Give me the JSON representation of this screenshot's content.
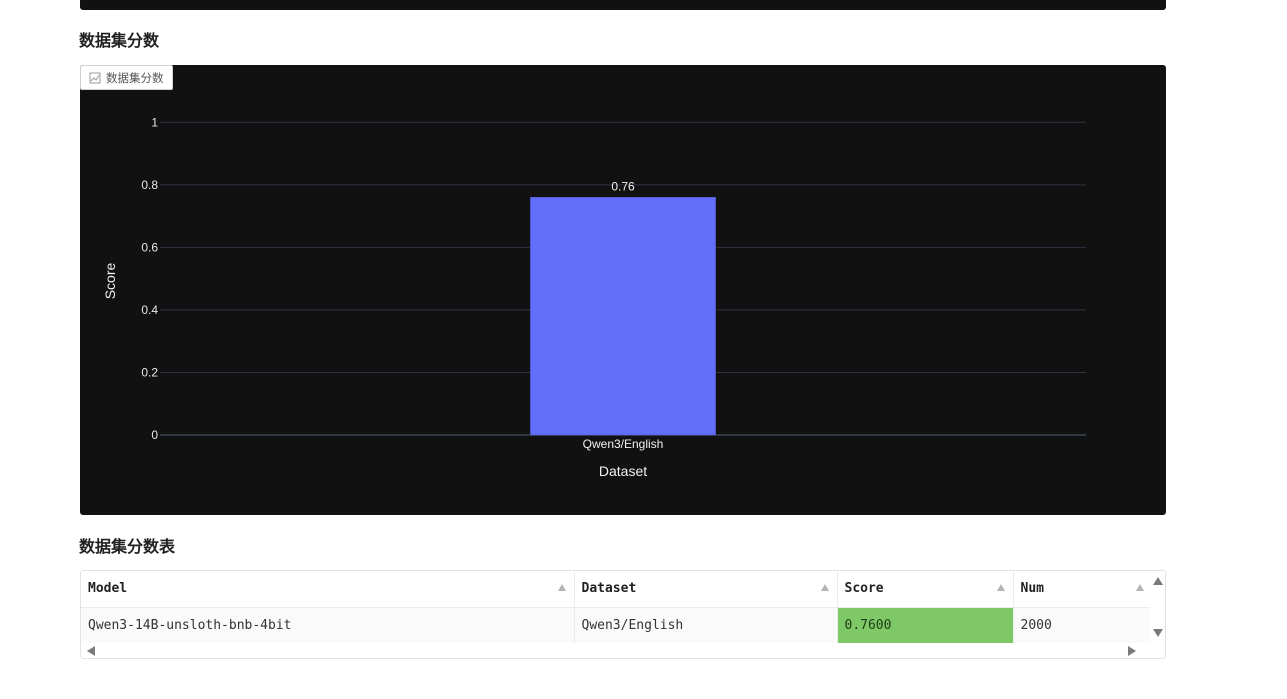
{
  "sections": {
    "chart_heading": "数据集分数",
    "table_heading": "数据集分数表"
  },
  "chart_tag": {
    "label": "数据集分数",
    "icon": "chart-icon"
  },
  "colors": {
    "bar": "#636efa",
    "panel_bg": "#111111",
    "grid": "#2d3340",
    "score_highlight": "#7ec868"
  },
  "chart_data": {
    "type": "bar",
    "categories": [
      "Qwen3/English"
    ],
    "values": [
      0.76
    ],
    "data_labels": [
      "0.76"
    ],
    "xlabel": "Dataset",
    "ylabel": "Score",
    "ylim": [
      0,
      1.1
    ],
    "yticks": [
      0,
      0.2,
      0.4,
      0.6,
      0.8,
      1
    ],
    "ytick_labels": [
      "0",
      "0.2",
      "0.4",
      "0.6",
      "0.8",
      "1"
    ],
    "grid": true,
    "legend": "none"
  },
  "table": {
    "columns": [
      "Model",
      "Dataset",
      "Score",
      "Num"
    ],
    "rows": [
      [
        "Qwen3-14B-unsloth-bnb-4bit",
        "Qwen3/English",
        "0.7600",
        "2000"
      ]
    ]
  }
}
